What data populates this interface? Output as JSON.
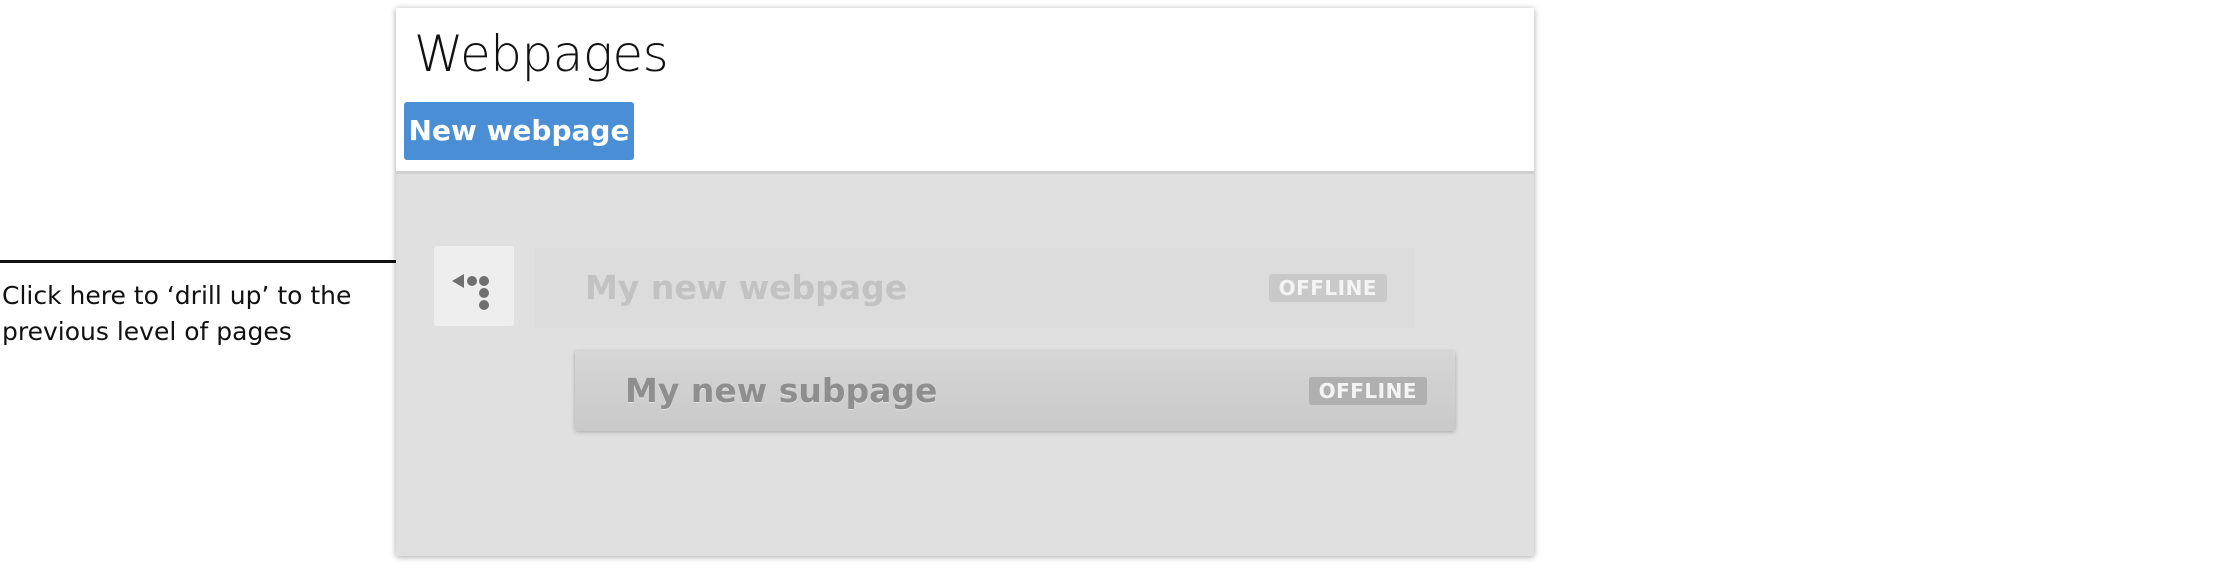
{
  "annotation": {
    "line1": "Click here to ‘drill up’ to the",
    "line2": "previous level of pages"
  },
  "header": {
    "title": "Webpages",
    "new_button_label": "New webpage"
  },
  "drill_up": {
    "icon": "drill-up-icon"
  },
  "pages": [
    {
      "label": "My new webpage",
      "status": "OFFLINE"
    },
    {
      "label": "My new subpage",
      "status": "OFFLINE"
    }
  ],
  "colors": {
    "accent": "#4a8fd6",
    "panel_background": "#e0e0e0",
    "badge_background": "#b0b0b0"
  }
}
